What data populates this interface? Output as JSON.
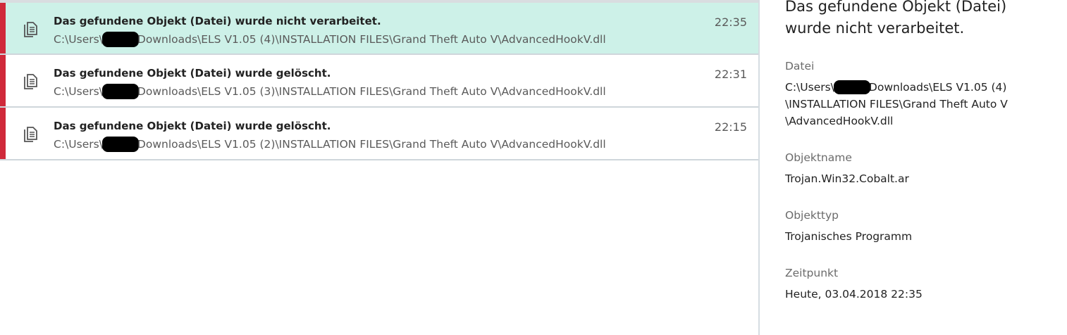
{
  "events": [
    {
      "title": "Das gefundene Objekt (Datei) wurde nicht verarbeitet.",
      "path_prefix": "C:\\Users\\",
      "path_suffix": "Downloads\\ELS V1.05 (4)\\INSTALLATION FILES\\Grand Theft Auto V\\AdvancedHookV.dll",
      "time": "22:35",
      "selected": true,
      "icon": "file-copy-icon",
      "severity_color": "#d0293a"
    },
    {
      "title": "Das gefundene Objekt (Datei) wurde gelöscht.",
      "path_prefix": "C:\\Users\\",
      "path_suffix": "Downloads\\ELS V1.05 (3)\\INSTALLATION FILES\\Grand Theft Auto V\\AdvancedHookV.dll",
      "time": "22:31",
      "selected": false,
      "icon": "file-copy-icon",
      "severity_color": "#d0293a"
    },
    {
      "title": "Das gefundene Objekt (Datei) wurde gelöscht.",
      "path_prefix": "C:\\Users\\",
      "path_suffix": "Downloads\\ELS V1.05 (2)\\INSTALLATION FILES\\Grand Theft Auto V\\AdvancedHookV.dll",
      "time": "22:15",
      "selected": false,
      "icon": "file-copy-icon",
      "severity_color": "#d0293a"
    }
  ],
  "details": {
    "heading": "Das gefundene Objekt (Datei) wurde nicht verarbeitet.",
    "file_label": "Datei",
    "file_line1_prefix": "C:\\Users\\",
    "file_line1_suffix": "Downloads\\ELS V1.05 (4)",
    "file_line2": "\\INSTALLATION FILES\\Grand Theft Auto V",
    "file_line3": "\\AdvancedHookV.dll",
    "object_name_label": "Objektname",
    "object_name": "Trojan.Win32.Cobalt.ar",
    "object_type_label": "Objekttyp",
    "object_type": "Trojanisches Programm",
    "timestamp_label": "Zeitpunkt",
    "timestamp": "Heute, 03.04.2018 22:35"
  },
  "colors": {
    "selected_row": "#cdf1e8",
    "severity_red": "#d0293a",
    "redaction": "#000000"
  }
}
